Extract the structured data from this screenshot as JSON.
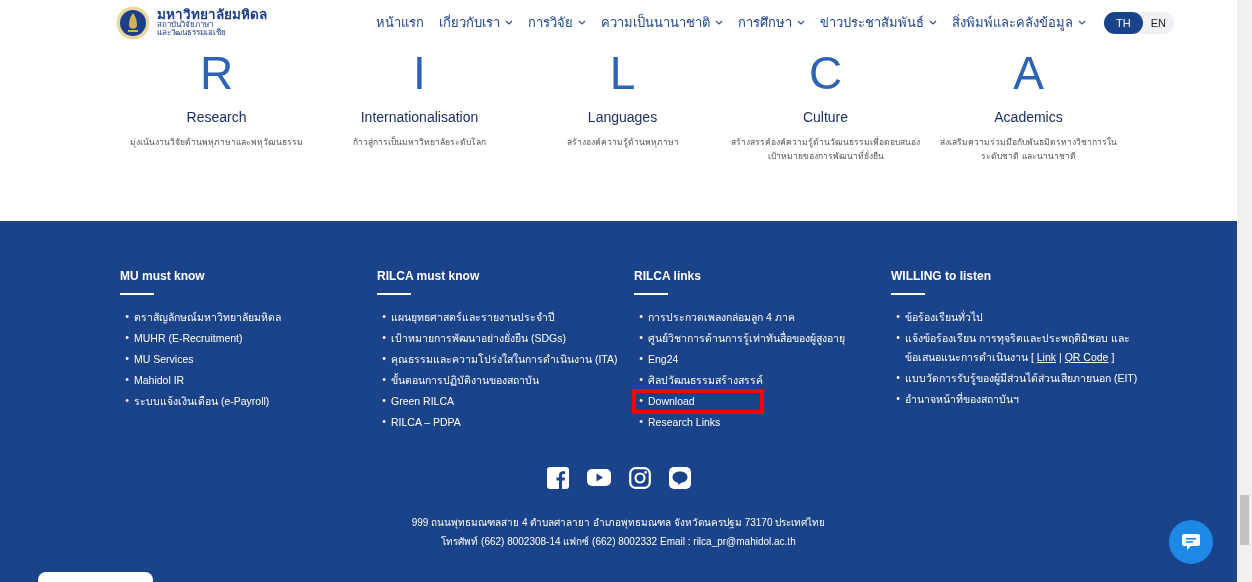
{
  "header": {
    "logo_title": "มหาวิทยาลัยมหิดล",
    "logo_subtitle": [
      "สถาบันวิจัยภาษา",
      "และวัฒนธรรมเอเชีย"
    ],
    "nav": [
      {
        "label": "หน้าแรก",
        "dropdown": false
      },
      {
        "label": "เกี่ยวกับเรา",
        "dropdown": true
      },
      {
        "label": "การวิจัย",
        "dropdown": true
      },
      {
        "label": "ความเป็นนานาชาติ",
        "dropdown": true
      },
      {
        "label": "การศึกษา",
        "dropdown": true
      },
      {
        "label": "ข่าวประชาสัมพันธ์",
        "dropdown": true
      },
      {
        "label": "สิ่งพิมพ์และคลังข้อมูล",
        "dropdown": true
      }
    ],
    "languages": [
      {
        "label": "TH",
        "selected": true
      },
      {
        "label": "EN",
        "selected": false
      }
    ]
  },
  "pillars": [
    {
      "letter": "R",
      "title": "Research",
      "description": "มุ่งเน้นงานวิจัยด้านพหุภาษาและพหุวัฒนธรรม"
    },
    {
      "letter": "I",
      "title": "Internationalisation",
      "description": "ก้าวสู่การเป็นมหาวิทยาลัยระดับโลก"
    },
    {
      "letter": "L",
      "title": "Languages",
      "description": "สร้างองค์ความรู้ด้านพหุภาษา"
    },
    {
      "letter": "C",
      "title": "Culture",
      "description": "สร้างสรรค์องค์ความรู้ด้านวัฒนธรรมเพื่อตอบสนองเป้าหมายของการพัฒนาที่ยั่งยืน"
    },
    {
      "letter": "A",
      "title": "Academics",
      "description": "ส่งเสริมความร่วมมือกับพันธมิตรทางวิชาการในระดับชาติ และนานาชาติ"
    }
  ],
  "footer": {
    "columns": [
      {
        "title": "MU must know",
        "items": [
          {
            "marker": "•",
            "segments": [
              {
                "kind": "text",
                "text": "ตราสัญลักษณ์มหาวิทยาลัยมหิดล"
              }
            ],
            "highlighted": false
          },
          {
            "marker": "•",
            "segments": [
              {
                "kind": "text",
                "text": "MUHR (E-Recruitment)"
              }
            ],
            "highlighted": false
          },
          {
            "marker": "•",
            "segments": [
              {
                "kind": "text",
                "text": "MU Services"
              }
            ],
            "highlighted": false
          },
          {
            "marker": "•",
            "segments": [
              {
                "kind": "text",
                "text": "Mahidol IR"
              }
            ],
            "highlighted": false
          },
          {
            "marker": "•",
            "segments": [
              {
                "kind": "text",
                "text": "ระบบแจ้งเงินเดือน (e-Payroll)"
              }
            ],
            "highlighted": false
          }
        ]
      },
      {
        "title": "RILCA must know",
        "items": [
          {
            "marker": "•",
            "segments": [
              {
                "kind": "text",
                "text": "แผนยุทธศาสตร์และรายงานประจำปี"
              }
            ],
            "highlighted": false
          },
          {
            "marker": "•",
            "segments": [
              {
                "kind": "text",
                "text": "เป้าหมายการพัฒนาอย่างยั่งยืน (SDGs)"
              }
            ],
            "highlighted": false
          },
          {
            "marker": "•",
            "segments": [
              {
                "kind": "text",
                "text": "คุณธรรมและความโปร่งใสในการดำเนินงาน (ITA)"
              }
            ],
            "highlighted": false
          },
          {
            "marker": "•",
            "segments": [
              {
                "kind": "text",
                "text": "ขั้นตอนการปฏิบัติงานของสถาบัน"
              }
            ],
            "highlighted": false
          },
          {
            "marker": "•",
            "segments": [
              {
                "kind": "text",
                "text": "Green RILCA"
              }
            ],
            "highlighted": false
          },
          {
            "marker": "•",
            "segments": [
              {
                "kind": "text",
                "text": "RILCA – PDPA"
              }
            ],
            "highlighted": false
          }
        ]
      },
      {
        "title": "RILCA links",
        "items": [
          {
            "marker": "•",
            "segments": [
              {
                "kind": "text",
                "text": "การประกวดเพลงกล่อมลูก 4 ภาค"
              }
            ],
            "highlighted": false
          },
          {
            "marker": "•",
            "segments": [
              {
                "kind": "text",
                "text": "ศูนย์วิชาการด้านการรู้เท่าทันสื่อของผู้สูงอายุ"
              }
            ],
            "highlighted": false
          },
          {
            "marker": "•",
            "segments": [
              {
                "kind": "text",
                "text": "Eng24"
              }
            ],
            "highlighted": false
          },
          {
            "marker": "•",
            "segments": [
              {
                "kind": "text",
                "text": "ศิลปวัฒนธรรมสร้างสรรค์"
              }
            ],
            "highlighted": false
          },
          {
            "marker": "•",
            "segments": [
              {
                "kind": "text",
                "text": "Download"
              }
            ],
            "highlighted": true
          },
          {
            "marker": "•",
            "segments": [
              {
                "kind": "text",
                "text": "Research Links"
              }
            ],
            "highlighted": false
          }
        ]
      },
      {
        "title": "WILLING to listen",
        "items": [
          {
            "marker": "•",
            "segments": [
              {
                "kind": "text",
                "text": "ข้อร้องเรียนทั่วไป"
              }
            ],
            "highlighted": false
          },
          {
            "marker": "•",
            "segments": [
              {
                "kind": "text",
                "text": "แจ้งข้อร้องเรียน การทุจริตและประพฤติมิชอบ และข้อเสนอแนะการดำเนินงาน ["
              },
              {
                "kind": "link",
                "text": "Link"
              },
              {
                "kind": "text",
                "text": "|"
              },
              {
                "kind": "link",
                "text": "QR Code"
              },
              {
                "kind": "text",
                "text": "]"
              }
            ],
            "highlighted": false
          },
          {
            "marker": "•",
            "segments": [
              {
                "kind": "text",
                "text": "แบบวัดการรับรู้ของผู้มีส่วนได้ส่วนเสียภายนอก (EIT)"
              }
            ],
            "highlighted": false
          },
          {
            "marker": "•",
            "segments": [
              {
                "kind": "text",
                "text": "อำนาจหน้าที่ของสถาบันฯ"
              }
            ],
            "highlighted": false
          }
        ]
      }
    ],
    "social": [
      {
        "kind": "facebook"
      },
      {
        "kind": "youtube"
      },
      {
        "kind": "instagram"
      },
      {
        "kind": "line"
      }
    ],
    "address": [
      "999 ถนนพุทธมณฑลสาย 4 ตำบลศาลายา อำเภอพุทธมณฑล จังหวัดนครปฐม 73170 ประเทศไทย",
      "โทรศัพท์ (662) 8002308-14 แฟกซ์ (662) 8002332 Email : rilca_pr@mahidol.ac.th"
    ]
  }
}
